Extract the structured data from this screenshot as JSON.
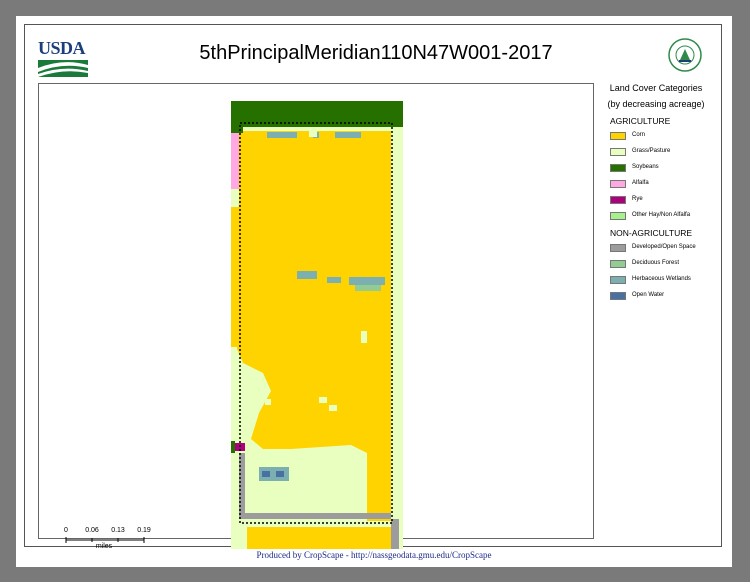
{
  "header": {
    "logo_text": "USDA",
    "title": "5thPrincipalMeridian110N47W001-2017"
  },
  "legend": {
    "title": "Land Cover Categories",
    "subtitle": "(by decreasing acreage)",
    "agriculture_heading": "AGRICULTURE",
    "agriculture": [
      {
        "label": "Corn",
        "color": "#ffd300"
      },
      {
        "label": "Grass/Pasture",
        "color": "#e8ffbf"
      },
      {
        "label": "Soybeans",
        "color": "#267000"
      },
      {
        "label": "Alfalfa",
        "color": "#ffa8e2"
      },
      {
        "label": "Rye",
        "color": "#ad007c"
      },
      {
        "label": "Other Hay/Non Alfalfa",
        "color": "#a5f28c"
      }
    ],
    "non_agriculture_heading": "NON-AGRICULTURE",
    "non_agriculture": [
      {
        "label": "Developed/Open Space",
        "color": "#9c9c9c"
      },
      {
        "label": "Deciduous Forest",
        "color": "#93cc93"
      },
      {
        "label": "Herbaceous Wetlands",
        "color": "#7cafaf"
      },
      {
        "label": "Open Water",
        "color": "#4970a3"
      }
    ]
  },
  "scalebar": {
    "ticks": [
      "0",
      "0.06",
      "0.13",
      "0.19"
    ],
    "unit": "miles"
  },
  "footer": {
    "credit": "Produced by CropScape - http://nassgeodata.gmu.edu/CropScape"
  }
}
